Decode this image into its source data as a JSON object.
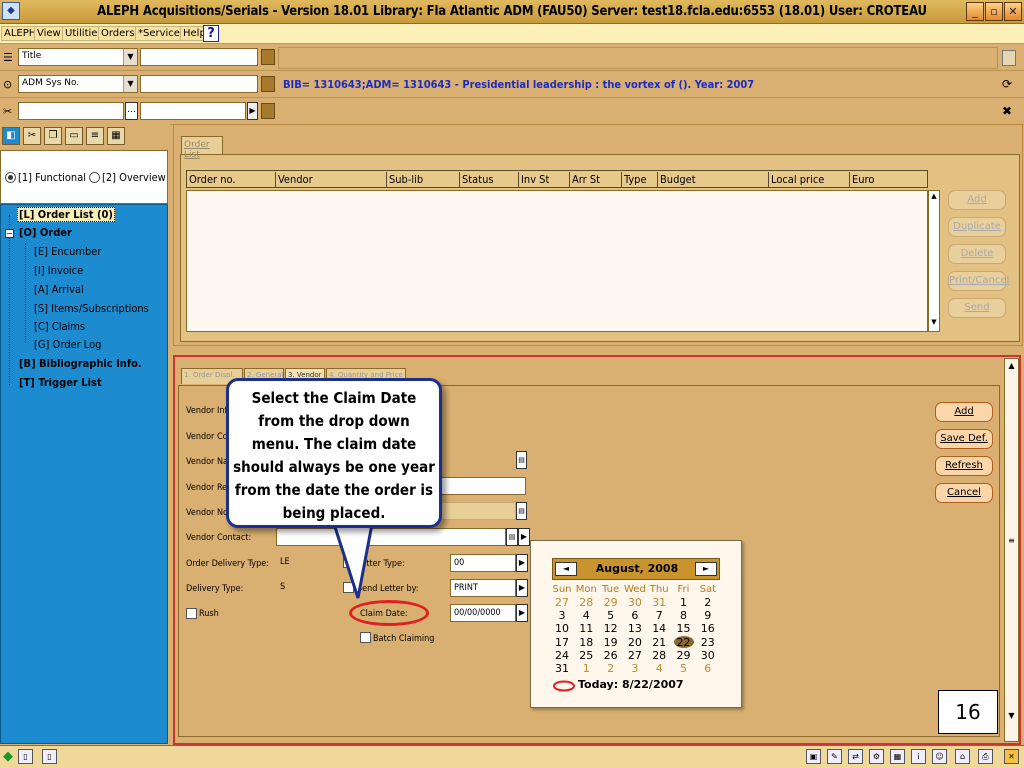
{
  "window": {
    "title": "ALEPH Acquisitions/Serials - Version 18.01  Library:  Fla Atlantic ADM (FAU50)  Server:  test18.fcla.edu:6553 (18.01)  User:  CROTEAU",
    "minimize": "_",
    "maximize": "▫",
    "close": "✕"
  },
  "menu": {
    "items": [
      "ALEPH",
      "View",
      "Utilities",
      "Orders",
      "*Services",
      "Help"
    ],
    "help_q": "?"
  },
  "search": {
    "row1_select": "Title",
    "row2_select": "ADM Sys No.",
    "bib_info": "BIB= 1310643;ADM= 1310643 - Presidential leadership : the vortex of (). Year: 2007"
  },
  "left_panel": {
    "radio_functional": "[1] Functional",
    "radio_overview": "[2] Overview",
    "tree": [
      {
        "label": "[L] Order List (0)",
        "level": 0,
        "bold": true,
        "selected": true
      },
      {
        "label": "[O] Order",
        "level": 0,
        "bold": true
      },
      {
        "label": "[E] Encumber",
        "level": 1
      },
      {
        "label": "[I] Invoice",
        "level": 1
      },
      {
        "label": "[A] Arrival",
        "level": 1
      },
      {
        "label": "[S] Items/Subscriptions",
        "level": 1
      },
      {
        "label": "[C] Claims",
        "level": 1
      },
      {
        "label": "[G] Order Log",
        "level": 1
      },
      {
        "label": "[B] Bibliographic Info.",
        "level": 0,
        "bold": true
      },
      {
        "label": "[T] Trigger List",
        "level": 0,
        "bold": true
      }
    ]
  },
  "order_list": {
    "tab": "Order List",
    "columns": [
      "Order no.",
      "Vendor",
      "Sub-lib",
      "Status",
      "Inv St",
      "Arr St",
      "Type",
      "Budget",
      "Local price",
      "Euro"
    ],
    "buttons": [
      "Add",
      "Duplicate",
      "Delete",
      "Print/Cancel",
      "Send"
    ]
  },
  "detail": {
    "tabs": [
      "1. Order Displ.",
      "2. General",
      "3. Vendor",
      "4. Quantity and Price"
    ],
    "labels": {
      "vendor_info": "Vendor Info",
      "vendor_code": "Vendor Cod",
      "vendor_name": "Vendor Nan",
      "vendor_ref": "Vendor Ref",
      "vendor_note": "Vendor Not",
      "vendor_contact": "Vendor Contact:",
      "order_delivery_type": "Order Delivery Type:",
      "delivery_type": "Delivery Type:",
      "rush": "Rush",
      "letter_type": "Letter Type:",
      "send_letter_by": "Send Letter by:",
      "claim_date": "Claim Date:",
      "batch_claiming": "Batch Claiming"
    },
    "values": {
      "order_delivery_type": "LE",
      "delivery_type": "S",
      "letter_type": "00",
      "send_letter_by": "PRINT",
      "claim_date": "00/00/0000"
    },
    "buttons": [
      "Add",
      "Save Def.",
      "Refresh",
      "Cancel"
    ]
  },
  "callout": {
    "text": "Select the Claim Date from the drop down menu. The claim date should always be one year from the date the order is being placed."
  },
  "calendar": {
    "month": "August, 2008",
    "prev": "◄",
    "next": "►",
    "dow": [
      "Sun",
      "Mon",
      "Tue",
      "Wed",
      "Thu",
      "Fri",
      "Sat"
    ],
    "weeks": [
      [
        "27",
        "28",
        "29",
        "30",
        "31",
        "1",
        "2"
      ],
      [
        "3",
        "4",
        "5",
        "6",
        "7",
        "8",
        "9"
      ],
      [
        "10",
        "11",
        "12",
        "13",
        "14",
        "15",
        "16"
      ],
      [
        "17",
        "18",
        "19",
        "20",
        "21",
        "22",
        "23"
      ],
      [
        "24",
        "25",
        "26",
        "27",
        "28",
        "29",
        "30"
      ],
      [
        "31",
        "1",
        "2",
        "3",
        "4",
        "5",
        "6"
      ]
    ],
    "today_label": "Today: 8/22/2007",
    "highlight": "22"
  },
  "slide_number": "16",
  "colors": {
    "panel_bg": "#d9b071",
    "tree_bg": "#1d8bd0",
    "bib_text": "#1a2cc6",
    "callout_border": "#1b2f8c",
    "claim_highlight": "#e02020"
  }
}
